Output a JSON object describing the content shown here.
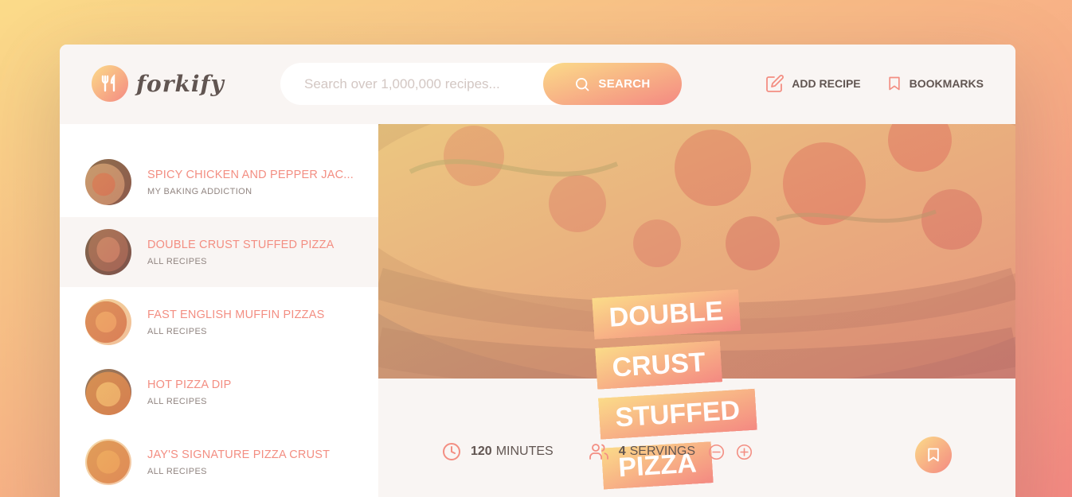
{
  "logo": {
    "text": "forkify",
    "icon": "fork-knife-icon"
  },
  "search": {
    "placeholder": "Search over 1,000,000 recipes...",
    "value": "",
    "button_label": "SEARCH"
  },
  "nav": [
    {
      "label": "ADD RECIPE",
      "icon": "edit-icon"
    },
    {
      "label": "BOOKMARKS",
      "icon": "bookmark-icon"
    }
  ],
  "results": [
    {
      "title": "SPICY CHICKEN AND PEPPER JAC...",
      "publisher": "MY BAKING ADDICTION",
      "active": false
    },
    {
      "title": "DOUBLE CRUST STUFFED PIZZA",
      "publisher": "ALL RECIPES",
      "active": true
    },
    {
      "title": "FAST ENGLISH MUFFIN PIZZAS",
      "publisher": "ALL RECIPES",
      "active": false
    },
    {
      "title": "HOT PIZZA DIP",
      "publisher": "ALL RECIPES",
      "active": false
    },
    {
      "title": "JAY'S SIGNATURE PIZZA CRUST",
      "publisher": "ALL RECIPES",
      "active": false
    }
  ],
  "recipe": {
    "title_line1": "DOUBLE CRUST",
    "title_line2": "STUFFED PIZZA",
    "minutes": "120",
    "minutes_label": "MINUTES",
    "servings": "4",
    "servings_label": "SERVINGS"
  },
  "colors": {
    "accent_start": "#fbdb89",
    "accent_end": "#f48982",
    "link": "#f38e82",
    "text": "#615551"
  }
}
